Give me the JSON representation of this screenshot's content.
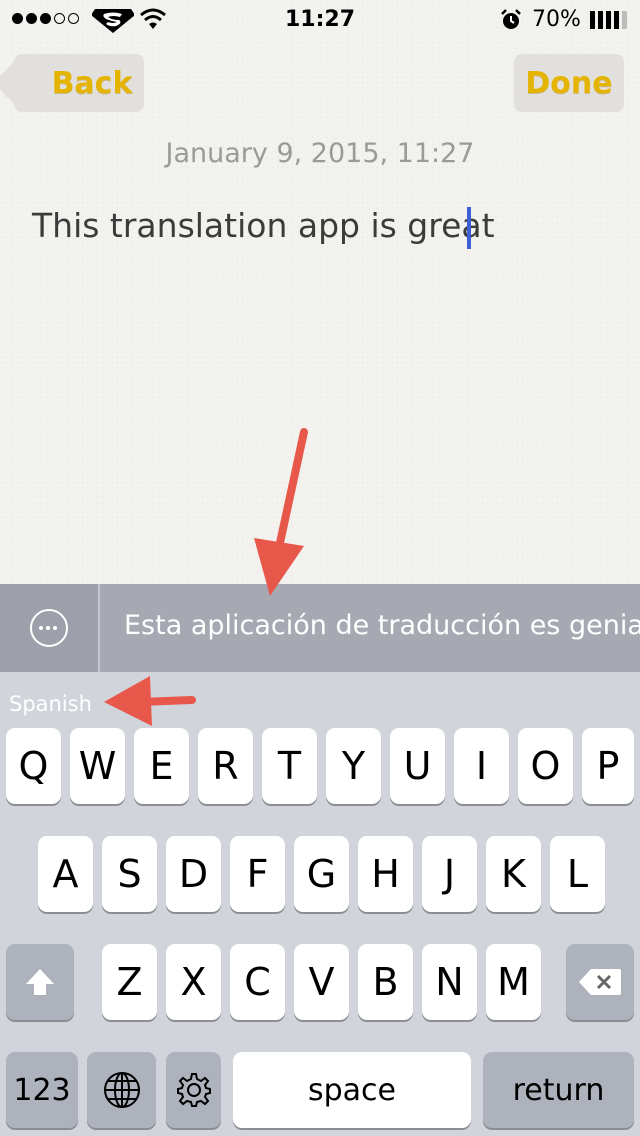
{
  "status_bar": {
    "time": "11:27",
    "battery_percent": "70%",
    "signal_bars_filled": 3,
    "signal_bars_total": 5,
    "icons": [
      "carrier-logo-icon",
      "wifi-icon",
      "alarm-icon",
      "battery-icon"
    ]
  },
  "nav": {
    "back_label": "Back",
    "done_label": "Done"
  },
  "note": {
    "date": "January 9, 2015, 11:27",
    "text": "This translation app is great"
  },
  "translation": {
    "text": "Esta aplicación de traducción es genial",
    "language": "Spanish"
  },
  "keyboard": {
    "row1": [
      "Q",
      "W",
      "E",
      "R",
      "T",
      "Y",
      "U",
      "I",
      "O",
      "P"
    ],
    "row2": [
      "A",
      "S",
      "D",
      "F",
      "G",
      "H",
      "J",
      "K",
      "L"
    ],
    "row3": [
      "Z",
      "X",
      "C",
      "V",
      "B",
      "N",
      "M"
    ],
    "num_label": "123",
    "space_label": "space",
    "return_label": "return"
  },
  "colors": {
    "accent": "#e5b400",
    "annotation_arrow": "#e8584a",
    "caret": "#3b5fd7"
  }
}
